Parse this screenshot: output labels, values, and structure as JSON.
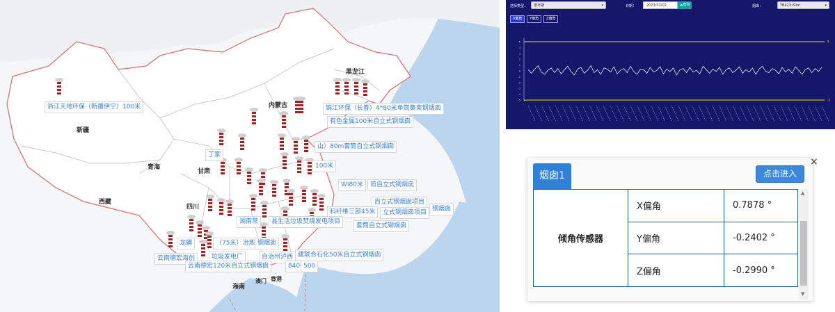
{
  "map": {
    "provinces": [
      {
        "key": "heilongjiang",
        "name": "黑龙江"
      },
      {
        "key": "neimenggu",
        "name": "内蒙古"
      },
      {
        "key": "xinjiang",
        "name": "新疆"
      },
      {
        "key": "qinghai",
        "name": "青海"
      },
      {
        "key": "gansu",
        "name": "甘肃"
      },
      {
        "key": "xizang",
        "name": "西藏"
      },
      {
        "key": "sichuan",
        "name": "四川"
      },
      {
        "key": "hainan",
        "name": "海南"
      }
    ],
    "cities": [
      {
        "key": "macau",
        "name": "澳门"
      },
      {
        "key": "hongkong",
        "name": "香港"
      }
    ],
    "site_labels": [
      "浙江天地环保（新疆伊宁）100米",
      "锦江环保（长春）4*80米单筒集束钢烟囱",
      "有色金属100米自立式钢烟囱",
      "山）80m套筒自立式钢烟囱",
      "丁家",
      "100米",
      "WI80米",
      "简自立式钢烟囱",
      "自立式钢烟囱项目",
      "科纤维三部45米",
      "立式钢烟囱项目",
      "钢烟囱",
      "湖南常",
      "县生活垃圾焚烧发电项目",
      "套筒自立式钢烟囱",
      "龙蟒",
      "（75米）冶炼",
      "钢烟囱",
      "建联合石化50米自立式钢烟囱",
      "云南德宏海创",
      "垃圾发电厂",
      "自治州泸西",
      "云南德宏120米自立式钢烟囱",
      "8400",
      "500"
    ]
  },
  "monitor": {
    "type_label": "选择类型：",
    "type_value": "按日期",
    "date_label": "日期：",
    "date_value": "2023/03/02",
    "search_label": "查询",
    "chimney_label": "烟囱：",
    "chimney_value": "YB423-60m",
    "axis_tabs": [
      "X偏角",
      "Y偏角",
      "Z偏角"
    ],
    "upper_limit_label": "5",
    "lower_limit_label": "-5"
  },
  "chart_data": {
    "type": "line",
    "title": "",
    "xlabel": "",
    "ylabel": "",
    "ylim": [
      -5,
      5
    ],
    "yticks": [
      5,
      4,
      3,
      2,
      1,
      0,
      -1,
      -2,
      -3,
      -4,
      -5
    ],
    "grid": false,
    "series": [
      {
        "values": [
          0.2,
          -0.4,
          0.3,
          0.9,
          -0.2,
          -0.6,
          0.1,
          0.5,
          -0.3,
          0.4,
          -0.5,
          0.2,
          0.8,
          -0.1,
          -0.7,
          0.3,
          0.6,
          -0.4,
          0.1,
          0.9,
          -0.3,
          0.2,
          -0.6,
          0.5,
          0.3,
          -0.2,
          0.7,
          -0.5,
          0.1,
          0.4,
          -0.3,
          0.8,
          -0.1,
          -0.6,
          0.3,
          0.2,
          -0.4,
          0.6,
          -0.2,
          0.1,
          0.7,
          -0.5,
          0.3,
          -0.1,
          0.5,
          -0.7,
          0.2,
          0.4,
          -0.3,
          0.6,
          -0.2,
          0.1,
          -0.5,
          0.8,
          0.2,
          -0.4,
          0.3,
          -0.1,
          0.6,
          -0.6,
          0.2,
          0.5,
          -0.3,
          0.1,
          0.7,
          -0.4,
          0.2,
          -0.2,
          0.5,
          -0.6,
          0.3,
          0.8,
          -0.1,
          -0.3,
          0.4,
          0.1,
          -0.5,
          0.6,
          -0.2,
          0.3,
          -0.4,
          0.7,
          0.1,
          -0.6,
          0.2,
          0.5,
          -0.3,
          0.4,
          -0.1,
          0.6
        ]
      },
      {
        "name": "upper",
        "values": [
          5
        ]
      },
      {
        "name": "lower",
        "values": [
          -5
        ]
      }
    ]
  },
  "popup": {
    "tab_label": "烟囱1",
    "enter_label": "点击进入",
    "close_label": "×",
    "group_label": "倾角传感器",
    "rows": [
      {
        "axis": "X偏角",
        "value": "0.7878 °"
      },
      {
        "axis": "Y偏角",
        "value": "-0.2402 °"
      },
      {
        "axis": "Z偏角",
        "value": "-0.2990 °"
      }
    ]
  }
}
